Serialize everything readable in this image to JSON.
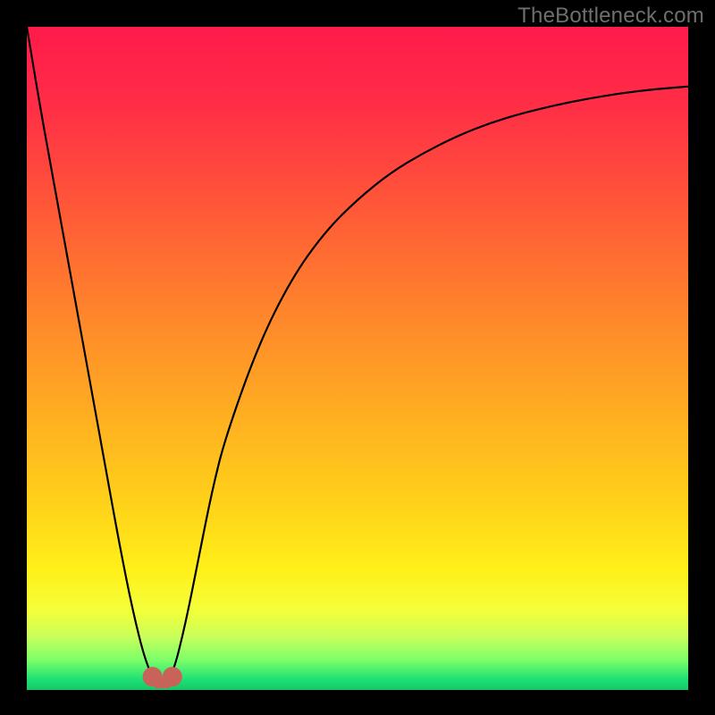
{
  "watermark": "TheBottleneck.com",
  "chart_data": {
    "type": "line",
    "title": "",
    "xlabel": "",
    "ylabel": "",
    "xlim": [
      0,
      100
    ],
    "ylim": [
      0,
      100
    ],
    "grid": false,
    "legend": false,
    "series": [
      {
        "name": "bottleneck-curve",
        "x": [
          0,
          2,
          4,
          6,
          8,
          10,
          12,
          14,
          16,
          18,
          20,
          22,
          24,
          26,
          28,
          30,
          35,
          40,
          45,
          50,
          55,
          60,
          65,
          70,
          75,
          80,
          85,
          90,
          95,
          100
        ],
        "values": [
          100,
          88,
          77,
          66,
          55,
          44,
          33,
          22,
          12,
          4,
          0,
          2,
          10,
          20,
          30,
          38,
          52,
          62,
          69,
          74,
          78,
          81,
          83.5,
          85.5,
          87,
          88.2,
          89.2,
          90,
          90.6,
          91
        ]
      }
    ],
    "annotations": [
      {
        "name": "marker-left",
        "x": 19,
        "y": 2
      },
      {
        "name": "marker-right",
        "x": 22,
        "y": 2
      }
    ],
    "gradient_background": {
      "stops": [
        {
          "pos": 0.0,
          "color": "#ff1a4b"
        },
        {
          "pos": 0.12,
          "color": "#ff2e46"
        },
        {
          "pos": 0.28,
          "color": "#ff5a37"
        },
        {
          "pos": 0.45,
          "color": "#ff8a2a"
        },
        {
          "pos": 0.6,
          "color": "#ffb220"
        },
        {
          "pos": 0.72,
          "color": "#ffd21a"
        },
        {
          "pos": 0.82,
          "color": "#fff01a"
        },
        {
          "pos": 0.88,
          "color": "#f4ff3a"
        },
        {
          "pos": 0.92,
          "color": "#c8ff5a"
        },
        {
          "pos": 0.955,
          "color": "#7cff6a"
        },
        {
          "pos": 0.985,
          "color": "#1bdf74"
        },
        {
          "pos": 1.0,
          "color": "#17c76a"
        }
      ]
    },
    "marker_color": "#c96259",
    "curve_color": "#000000"
  }
}
